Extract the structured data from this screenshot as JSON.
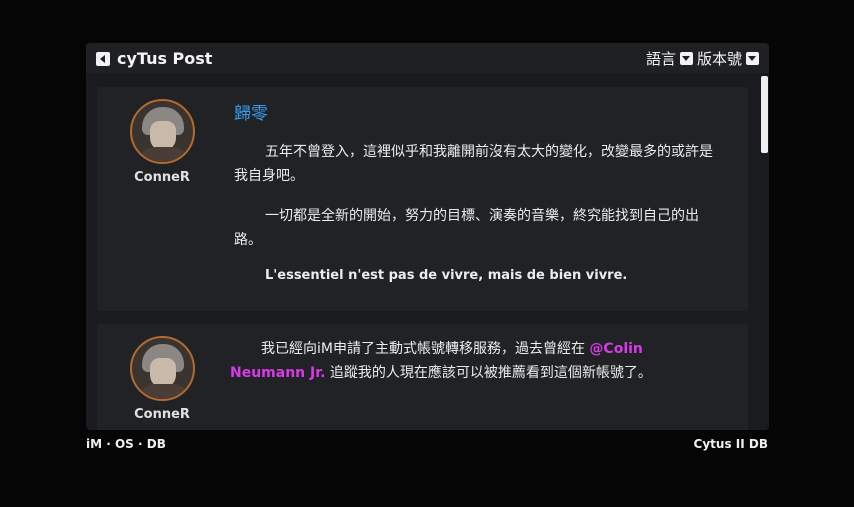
{
  "window": {
    "title": "cyTus Post",
    "language_label": "語言",
    "version_label": "版本號"
  },
  "posts": [
    {
      "author": "ConneR",
      "title": "歸零",
      "paragraphs": [
        "五年不曾登入，這裡似乎和我離開前沒有太大的變化，改變最多的或許是我自身吧。",
        "一切都是全新的開始，努力的目標、演奏的音樂，終究能找到自己的出路。"
      ],
      "quote": "L'essentiel n'est pas de vivre, mais de bien vivre."
    },
    {
      "author": "ConneR",
      "text_before": "我已經向iM申請了主動式帳號轉移服務，過去曾經在",
      "mention": "@Colin Neumann Jr.",
      "text_after": "追蹤我的人現在應該可以被推薦看到這個新帳號了。"
    }
  ],
  "footer": {
    "left": "iM · OS · DB",
    "right": "Cytus II DB"
  },
  "colors": {
    "title_blue": "#3a9be8",
    "mention_magenta": "#d63be6",
    "avatar_border": "#b36a2c"
  },
  "icons": {
    "back": "back-icon",
    "dropdown": "chevron-down-icon"
  }
}
